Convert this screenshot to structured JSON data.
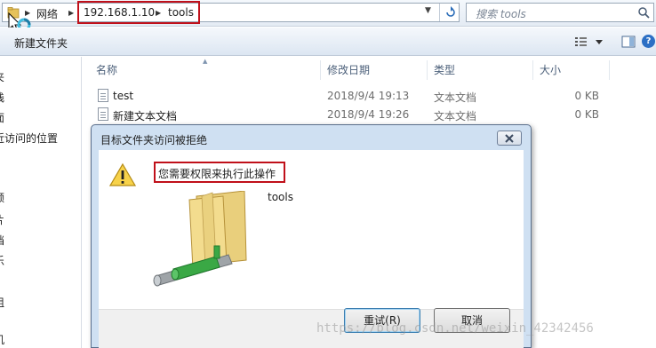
{
  "address_bar": {
    "crumbs": [
      "网络",
      "192.168.1.10",
      "tools"
    ],
    "search_placeholder": "搜索 tools"
  },
  "toolbar": {
    "new_folder_label": "新建文件夹"
  },
  "nav_pane": {
    "items": [
      "夹",
      "栈",
      "面",
      "近访问的位置",
      "频",
      "片",
      "档",
      "乐",
      "组",
      "机"
    ]
  },
  "file_list": {
    "columns": [
      "名称",
      "修改日期",
      "类型",
      "大小"
    ],
    "rows": [
      {
        "name": "test",
        "date": "2018/9/4 19:13",
        "type": "文本文档",
        "size": "0 KB"
      },
      {
        "name": "新建文本文档",
        "date": "2018/9/4 19:26",
        "type": "文本文档",
        "size": "0 KB"
      }
    ]
  },
  "dialog": {
    "title": "目标文件夹访问被拒绝",
    "message": "您需要权限来执行此操作",
    "folder_name": "tools",
    "retry_label": "重试(R)",
    "cancel_label": "取消"
  },
  "watermark": "https://blog.csdn.net/weixin_42342456",
  "colors": {
    "highlight_border": "#c0101a",
    "dialog_frame": "#cfe0f2",
    "column_header_text": "#4c607a"
  }
}
